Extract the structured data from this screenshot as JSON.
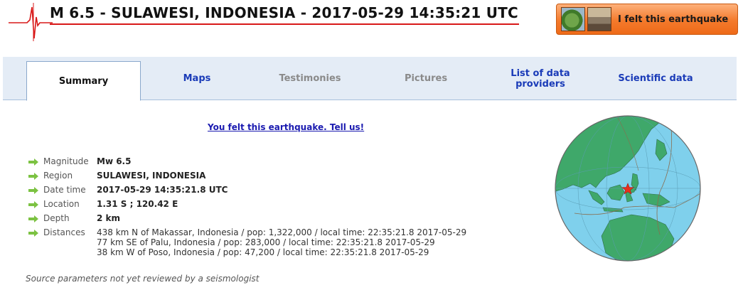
{
  "header": {
    "title": "M 6.5 - SULAWESI, INDONESIA - 2017-05-29 14:35:21 UTC",
    "felt_button_label": "I felt this earthquake"
  },
  "tabs": [
    {
      "label": "Summary",
      "state": "active"
    },
    {
      "label": "Maps",
      "state": "link"
    },
    {
      "label": "Testimonies",
      "state": "disabled"
    },
    {
      "label": "Pictures",
      "state": "disabled"
    },
    {
      "label": "List of data providers",
      "state": "link"
    },
    {
      "label": "Scientific data",
      "state": "link"
    }
  ],
  "felt_link": "You felt this earthquake. Tell us!",
  "params": {
    "magnitude": {
      "label": "Magnitude",
      "value": "Mw 6.5"
    },
    "region": {
      "label": "Region",
      "value": "SULAWESI, INDONESIA"
    },
    "datetime": {
      "label": "Date time",
      "value": "2017-05-29 14:35:21.8 UTC"
    },
    "location": {
      "label": "Location",
      "value": "1.31 S ; 120.42 E"
    },
    "depth": {
      "label": "Depth",
      "value": "2 km"
    },
    "distances": {
      "label": "Distances",
      "lines": [
        "438 km N of Makassar, Indonesia / pop: 1,322,000 / local time: 22:35:21.8 2017-05-29",
        "77 km SE of Palu, Indonesia / pop: 283,000 / local time: 22:35:21.8 2017-05-29",
        "38 km W of Poso, Indonesia / pop: 47,200 / local time: 22:35:21.8 2017-05-29"
      ]
    }
  },
  "source_note": "Source parameters not yet reviewed by a seismologist",
  "colors": {
    "tab_link": "#1a3bb8",
    "tab_disabled": "#8a8a8a",
    "button_orange": "#f47a2c",
    "title_underline": "#d81818",
    "arrow_green": "#7cc242",
    "ocean": "#7fd0ec",
    "land": "#3fa86a",
    "epicenter": "#e8301c"
  }
}
